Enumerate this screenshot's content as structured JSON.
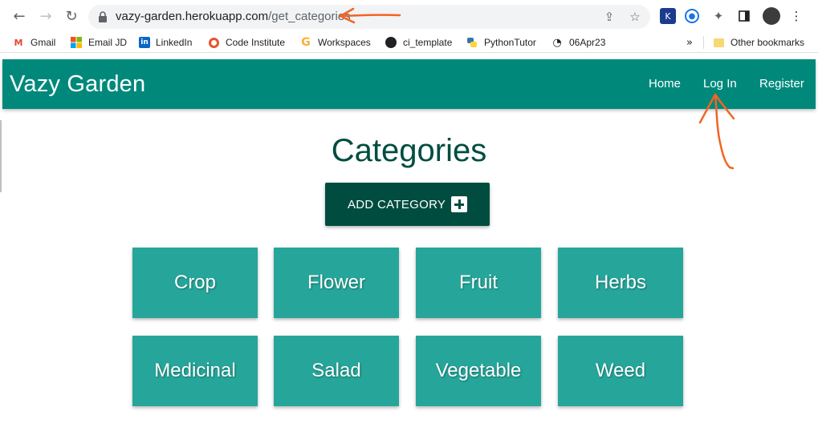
{
  "browser": {
    "url_domain": "vazy-garden.herokuapp.com",
    "url_path": "/get_categories",
    "bookmarks": [
      {
        "label": "Gmail",
        "icon": "gmail-icon",
        "color": "#ea4335"
      },
      {
        "label": "Email JD",
        "icon": "microsoft-icon",
        "color": "#f25022"
      },
      {
        "label": "LinkedIn",
        "icon": "linkedin-icon",
        "color": "#0a66c2"
      },
      {
        "label": "Code Institute",
        "icon": "code-institute-icon",
        "color": "#e5532d"
      },
      {
        "label": "Workspaces",
        "icon": "gitpod-icon",
        "color": "#ffae33"
      },
      {
        "label": "ci_template",
        "icon": "github-icon",
        "color": "#202124"
      },
      {
        "label": "PythonTutor",
        "icon": "python-icon",
        "color": "#3776ab"
      },
      {
        "label": "06Apr23",
        "icon": "loader-icon",
        "color": "#202124"
      }
    ],
    "other_bookmarks": "Other bookmarks"
  },
  "site": {
    "brand": "Vazy Garden",
    "nav": {
      "home": "Home",
      "login": "Log In",
      "register": "Register"
    }
  },
  "page": {
    "title": "Categories",
    "add_button_label": "ADD CATEGORY",
    "categories": [
      "Crop",
      "Flower",
      "Fruit",
      "Herbs",
      "Medicinal",
      "Salad",
      "Vegetable",
      "Weed"
    ]
  },
  "colors": {
    "navbar": "#00897b",
    "title": "#004d40",
    "button": "#004d40",
    "card": "#26a69a",
    "annotation": "#f26522"
  }
}
